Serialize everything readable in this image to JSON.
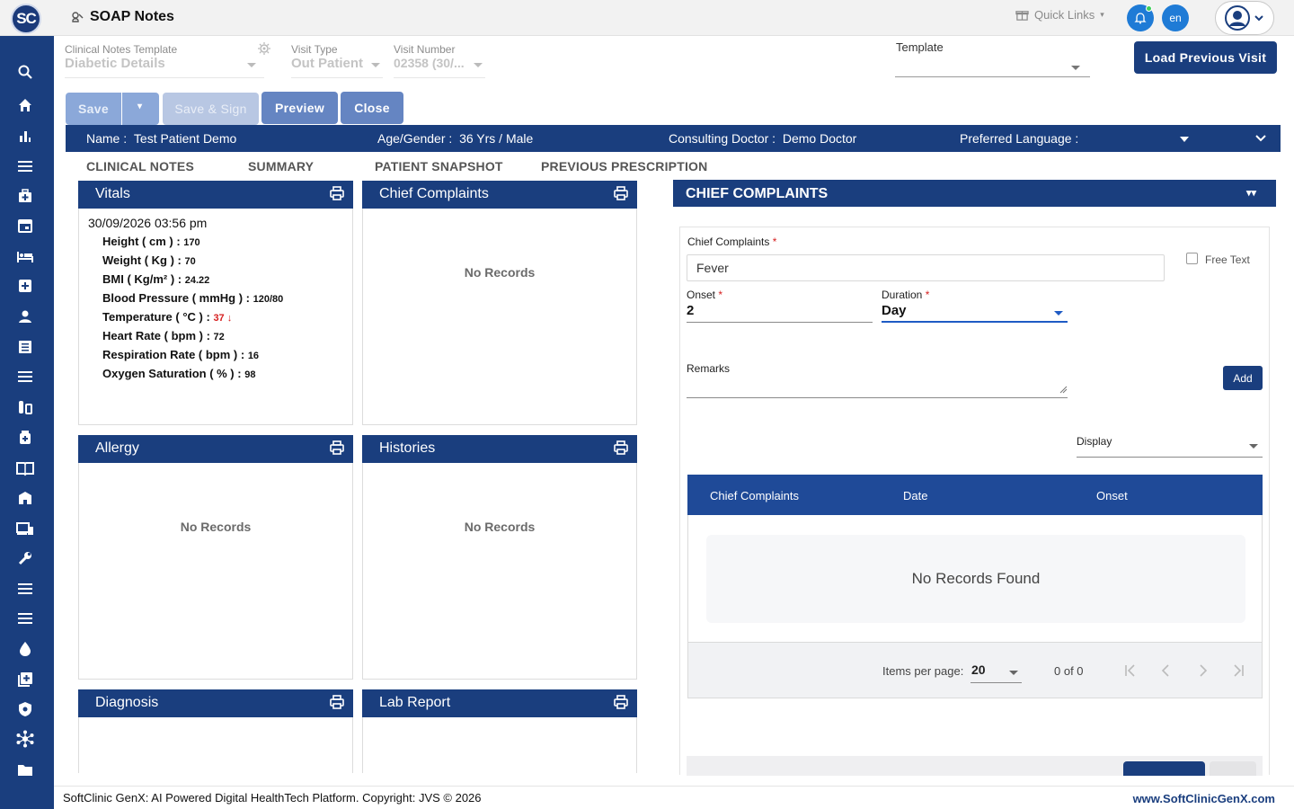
{
  "app": {
    "logo_text": "SC",
    "page_title": "SOAP Notes",
    "quick_links": "Quick Links",
    "lang": "en"
  },
  "sidebar": {
    "icons": [
      "search-icon",
      "home-icon",
      "bar-chart-icon",
      "menu-icon",
      "medical-bag-icon",
      "calendar-icon",
      "bed-icon",
      "plus-box-icon",
      "person-icon",
      "list-doc-icon",
      "menu-icon",
      "lab-icon",
      "medicine-icon",
      "book-icon",
      "building-icon",
      "devices-icon",
      "wrench-icon",
      "menu-icon",
      "menu-icon",
      "drop-icon",
      "add-box-icon",
      "shield-icon",
      "network-icon",
      "folder-icon"
    ]
  },
  "header_fields": {
    "template_label": "Clinical Notes Template",
    "template_value": "Diabetic Details",
    "visit_type_label": "Visit Type",
    "visit_type_value": "Out Patient",
    "visit_number_label": "Visit Number",
    "visit_number_value": "02358 (30/...",
    "template2_label": "Template",
    "template2_value": ""
  },
  "toolbar": {
    "save": "Save",
    "save_sign": "Save & Sign",
    "preview": "Preview",
    "close": "Close",
    "load_previous": "Load Previous Visit"
  },
  "patient": {
    "name_label": "Name :",
    "name_value": "Test Patient Demo",
    "age_label": "Age/Gender :",
    "age_value": "36 Yrs / Male",
    "doctor_label": "Consulting Doctor :",
    "doctor_value": "Demo Doctor",
    "lang_label": "Preferred Language :",
    "lang_value": ""
  },
  "tabs": [
    "CLINICAL NOTES",
    "SUMMARY",
    "PATIENT SNAPSHOT",
    "PREVIOUS PRESCRIPTION"
  ],
  "cards": {
    "vitals": {
      "title": "Vitals",
      "date": "30/09/2026 03:56 pm",
      "rows": [
        {
          "label": "Height ( cm ) :",
          "value": "170"
        },
        {
          "label": "Weight ( Kg ) :",
          "value": "70"
        },
        {
          "label": "BMI ( Kg/m² ) :",
          "value": "24.22"
        },
        {
          "label": "Blood Pressure ( mmHg ) :",
          "value": "120/80"
        },
        {
          "label": "Temperature ( °C ) :",
          "value": "37 ↓"
        },
        {
          "label": "Heart Rate ( bpm ) :",
          "value": "72"
        },
        {
          "label": "Respiration Rate ( bpm ) :",
          "value": "16"
        },
        {
          "label": "Oxygen Saturation ( % ) :",
          "value": "98"
        }
      ]
    },
    "chief_complaints": {
      "title": "Chief Complaints",
      "empty": "No Records"
    },
    "allergy": {
      "title": "Allergy",
      "empty": "No Records"
    },
    "histories": {
      "title": "Histories",
      "empty": "No Records"
    },
    "diagnosis": {
      "title": "Diagnosis"
    },
    "lab_report": {
      "title": "Lab Report"
    }
  },
  "cc_panel": {
    "title": "CHIEF COMPLAINTS",
    "cc_label": "Chief Complaints",
    "cc_value": "Fever",
    "free_text": "Free Text",
    "onset_label": "Onset",
    "onset_value": "2",
    "duration_label": "Duration",
    "duration_value": "Day",
    "remarks_label": "Remarks",
    "add": "Add",
    "display_label": "Display",
    "grid_headers": [
      "Chief Complaints",
      "Date",
      "Onset"
    ],
    "empty": "No Records Found",
    "items_per_page_label": "Items per page:",
    "items_per_page": "20",
    "range": "0 of 0"
  },
  "footer": {
    "left": "SoftClinic GenX: AI Powered Digital HealthTech Platform. Copyright: JVS © 2026",
    "right": "www.SoftClinicGenX.com"
  },
  "colors": {
    "brand": "#1a3e7e",
    "accent": "#1f7bd6"
  }
}
